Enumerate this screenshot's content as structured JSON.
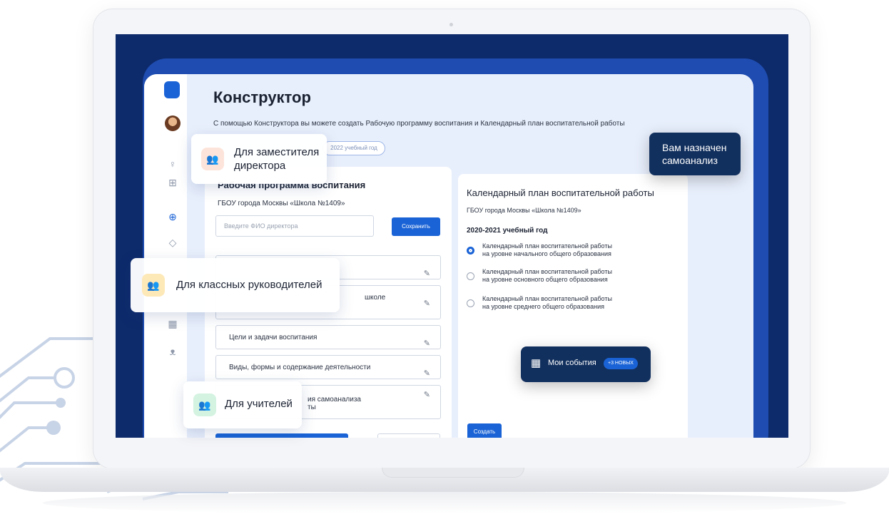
{
  "app": {
    "title": "Конструктор",
    "subtitle": "С помощью Конструктора вы можете создать Рабочую программу воспитания и Календарный план воспитательной работы",
    "year_chip": "2022 учебный год"
  },
  "sidebar": {
    "icons": [
      "lightbulb-icon",
      "hierarchy-icon",
      "globe-icon",
      "graduation-cap-icon",
      "calendar-icon",
      "people-icon"
    ]
  },
  "left_card": {
    "title": "Рабочая программа воспитания",
    "org": "ГБОУ города Москвы «Школа №1409»",
    "director_placeholder": "Введите ФИО директора",
    "save_label": "Сохранить",
    "sections": [
      {
        "label": ""
      },
      {
        "label": "школе"
      },
      {
        "label": "Цели и задачи воспитания"
      },
      {
        "label": "Виды, формы и содержание деятельности"
      },
      {
        "label": "ия самоанализа",
        "label2": "ты"
      }
    ]
  },
  "right_card": {
    "title": "Календарный план воспитательной работы",
    "org": "ГБОУ города Москвы «Школа №1409»",
    "year": "2020-2021 учебный год",
    "options": [
      {
        "line1": "Календарный план воспитательной работы",
        "line2": "на уровне начального общего образования",
        "checked": true
      },
      {
        "line1": "Календарный план воспитательной работы",
        "line2": "на уровне основного общего образования",
        "checked": false
      },
      {
        "line1": "Календарный план воспитательной работы",
        "line2": "на уровне среднего общего образования",
        "checked": false
      }
    ],
    "create_label": "Создать"
  },
  "chips": {
    "deputy": {
      "line1": "Для заместителя",
      "line2": "директора",
      "color": "#f0714a"
    },
    "class_teachers": {
      "label": "Для классных руководителей",
      "color": "#f5b82e"
    },
    "teachers": {
      "label": "Для учителей",
      "color": "#2dbf6f"
    }
  },
  "notifications": {
    "self_analysis": {
      "line1": "Вам назначен",
      "line2": "самоанализ"
    },
    "events": {
      "label": "Мои события",
      "badge": "+3 НОВЫХ"
    }
  },
  "colors": {
    "accent": "#1a63d6",
    "screen_bg": "#0d2a6b",
    "dark_chip": "#12305e"
  }
}
